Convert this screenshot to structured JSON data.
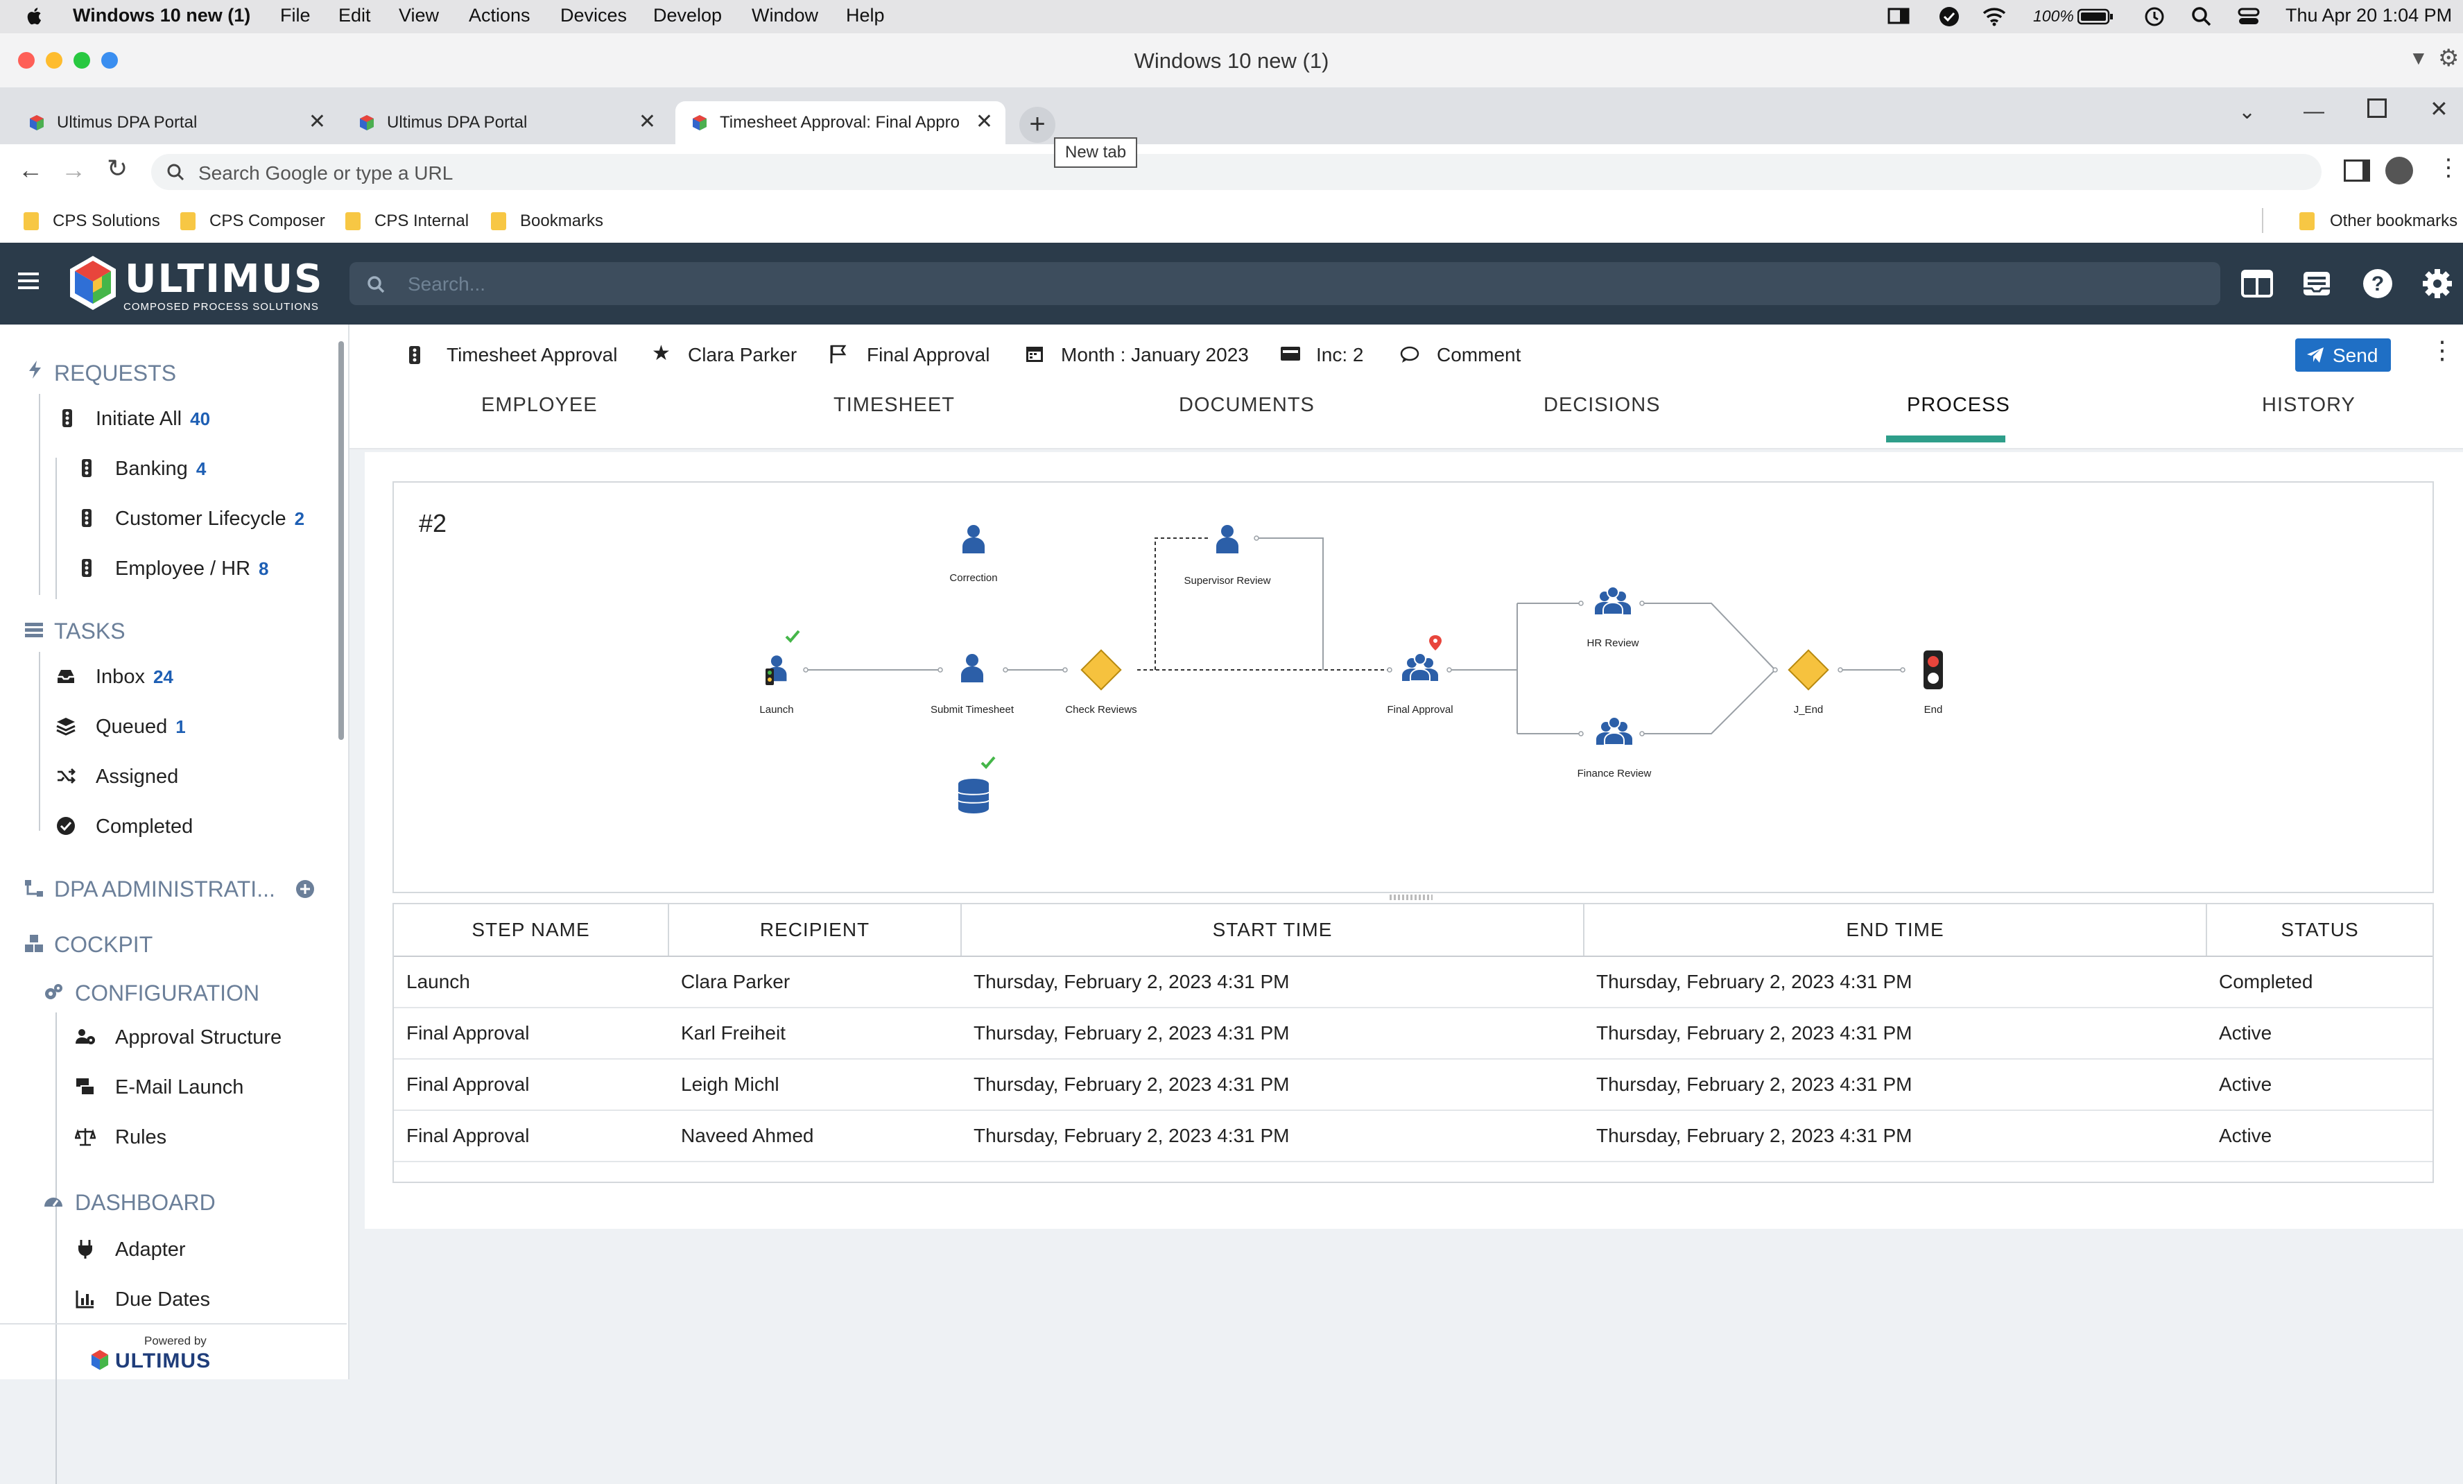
{
  "mac_menu": {
    "app": "Windows 10 new (1)",
    "items": [
      "File",
      "Edit",
      "View",
      "Actions",
      "Devices",
      "Develop",
      "Window",
      "Help"
    ],
    "battery": "100%",
    "datetime": "Thu Apr 20  1:04 PM"
  },
  "window": {
    "title": "Windows 10 new (1)"
  },
  "browser": {
    "tabs": [
      {
        "title": "Ultimus DPA Portal"
      },
      {
        "title": "Ultimus DPA Portal"
      },
      {
        "title": "Timesheet Approval: Final Appro"
      }
    ],
    "new_tab_tooltip": "New tab",
    "url_placeholder": "Search Google or type a URL",
    "bookmarks": [
      "CPS Solutions",
      "CPS Composer",
      "CPS Internal",
      "Bookmarks"
    ],
    "other_bookmarks": "Other bookmarks"
  },
  "app": {
    "logo_text": "ULTIMUS",
    "logo_sub": "COMPOSED PROCESS SOLUTIONS",
    "search_placeholder": "Search..."
  },
  "sidebar": {
    "requests_header": "REQUESTS",
    "requests": [
      {
        "label": "Initiate All",
        "count": "40"
      },
      {
        "label": "Banking",
        "count": "4"
      },
      {
        "label": "Customer Lifecycle",
        "count": "2"
      },
      {
        "label": "Employee / HR",
        "count": "8"
      }
    ],
    "tasks_header": "TASKS",
    "tasks": [
      {
        "label": "Inbox",
        "count": "24"
      },
      {
        "label": "Queued",
        "count": "1"
      },
      {
        "label": "Assigned",
        "count": ""
      },
      {
        "label": "Completed",
        "count": ""
      }
    ],
    "dpa_admin": "DPA ADMINISTRATI...",
    "cockpit": "COCKPIT",
    "configuration": "CONFIGURATION",
    "config_items": [
      "Approval Structure",
      "E-Mail Launch",
      "Rules"
    ],
    "dashboard": "DASHBOARD",
    "dashboard_items": [
      "Adapter",
      "Due Dates"
    ],
    "powered_by": "Powered by",
    "powered_logo": "ULTIMUS"
  },
  "header": {
    "process": "Timesheet Approval",
    "user": "Clara Parker",
    "step": "Final Approval",
    "period": "Month : January 2023",
    "incident": "Inc: 2",
    "comment": "Comment",
    "send": "Send"
  },
  "nav_tabs": [
    "EMPLOYEE",
    "TIMESHEET",
    "DOCUMENTS",
    "DECISIONS",
    "PROCESS",
    "HISTORY"
  ],
  "active_tab": "PROCESS",
  "accent_color": "#2e9e8a",
  "diagram": {
    "incident_label": "#2",
    "nodes": {
      "launch": "Launch",
      "submit": "Submit Timesheet",
      "check": "Check Reviews",
      "correction": "Correction",
      "supervisor": "Supervisor Review",
      "final": "Final Approval",
      "hr": "HR Review",
      "finance": "Finance Review",
      "jend": "J_End",
      "end": "End"
    }
  },
  "grid": {
    "columns": [
      "STEP NAME",
      "RECIPIENT",
      "START TIME",
      "END TIME",
      "STATUS"
    ],
    "rows": [
      [
        "Launch",
        "Clara Parker",
        "Thursday, February 2, 2023 4:31 PM",
        "Thursday, February 2, 2023 4:31 PM",
        "Completed"
      ],
      [
        "Final Approval",
        "Karl Freiheit",
        "Thursday, February 2, 2023 4:31 PM",
        "Thursday, February 2, 2023 4:31 PM",
        "Active"
      ],
      [
        "Final Approval",
        "Leigh Michl",
        "Thursday, February 2, 2023 4:31 PM",
        "Thursday, February 2, 2023 4:31 PM",
        "Active"
      ],
      [
        "Final Approval",
        "Naveed Ahmed",
        "Thursday, February 2, 2023 4:31 PM",
        "Thursday, February 2, 2023 4:31 PM",
        "Active"
      ]
    ]
  }
}
